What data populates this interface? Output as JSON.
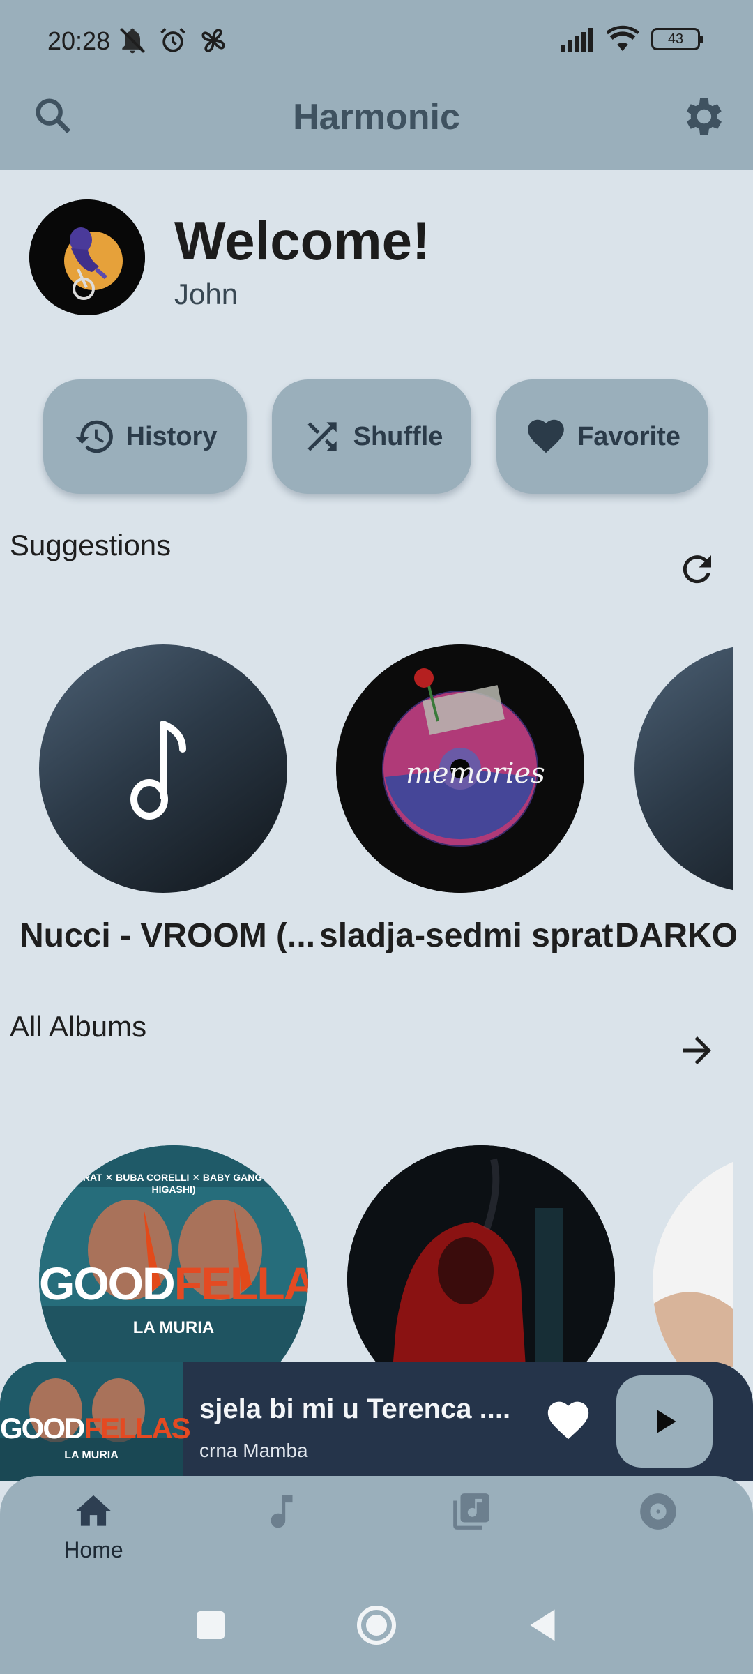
{
  "status_bar": {
    "time": "20:28",
    "battery": "43",
    "left_icons": [
      "do-not-disturb-icon",
      "alarm-icon",
      "fan-icon"
    ],
    "right_icons": [
      "signal-icon",
      "wifi-icon",
      "battery-icon"
    ]
  },
  "app_bar": {
    "title": "Harmonic",
    "search_icon": "search-icon",
    "settings_icon": "gear-icon"
  },
  "welcome": {
    "heading": "Welcome!",
    "username": "John"
  },
  "quick_actions": [
    {
      "label": "History",
      "icon": "history-icon"
    },
    {
      "label": "Shuffle",
      "icon": "shuffle-icon"
    },
    {
      "label": "Favorite",
      "icon": "heart-icon"
    }
  ],
  "suggestions": {
    "title": "Suggestions",
    "action_icon": "refresh-icon",
    "items": [
      {
        "title": "Nucci - VROOM (..."
      },
      {
        "title": "sladja-sedmi sprat"
      },
      {
        "title": "DARKO"
      }
    ]
  },
  "albums": {
    "title": "All Albums",
    "action_icon": "arrow-right-icon",
    "items": [
      {
        "cover_top_text": "JALA BRAT ✕ BUBA CORELLI ✕ BABY GANG (PROD. HIGASHI)",
        "cover_word_left": "GOOD",
        "cover_word_right": "FELLAS",
        "cover_sub": "LA MURIA"
      }
    ]
  },
  "player": {
    "title": "sjela bi mi u Terenca ....",
    "artist": "crna Mamba",
    "cover_word_left": "GOOD",
    "cover_word_right": "FELLAS",
    "cover_sub": "LA MURIA"
  },
  "bottom_nav": {
    "items": [
      {
        "label": "Home",
        "icon": "home-icon",
        "active": true
      },
      {
        "label": "",
        "icon": "music-note-icon",
        "active": false
      },
      {
        "label": "",
        "icon": "library-music-icon",
        "active": false
      },
      {
        "label": "",
        "icon": "album-icon",
        "active": false
      }
    ]
  },
  "colors": {
    "background": "#dae3ea",
    "surface": "#9aafbb",
    "title_text": "#3f5260",
    "player_bg": "#25344a"
  }
}
